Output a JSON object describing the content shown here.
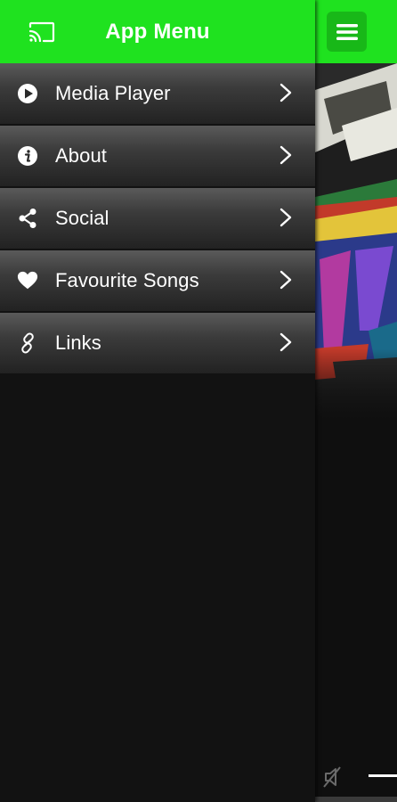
{
  "drawer": {
    "title": "App Menu",
    "header_color": "#1fe21f",
    "cast_icon": "cast-icon",
    "items": [
      {
        "label": "Media Player",
        "icon": "play-circle-icon"
      },
      {
        "label": "About",
        "icon": "info-icon"
      },
      {
        "label": "Social",
        "icon": "share-icon"
      },
      {
        "label": "Favourite Songs",
        "icon": "heart-icon"
      },
      {
        "label": "Links",
        "icon": "link-icon"
      }
    ]
  },
  "main": {
    "menu_button_icon": "hamburger-icon",
    "mute_icon": "volume-off-icon"
  }
}
